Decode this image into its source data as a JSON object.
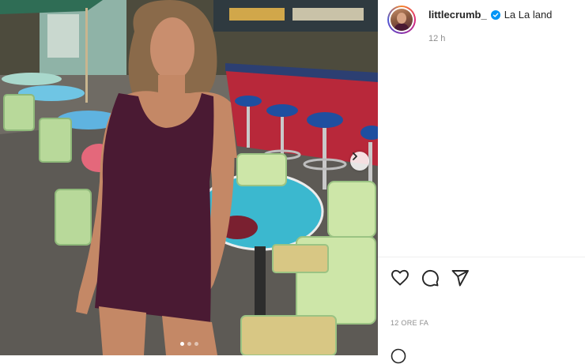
{
  "post": {
    "username": "littlecrumb_",
    "location": "La La land",
    "time_short": "12 h",
    "time_ago": "12 ORE FA",
    "carousel_dots": 3,
    "active_dot": 0
  },
  "icons": {
    "verified": "verified-badge-icon",
    "like": "heart-icon",
    "comment": "comment-icon",
    "share": "send-icon",
    "next": "chevron-right-icon"
  },
  "colors": {
    "verified_blue": "#0095f6",
    "text_primary": "#262626",
    "text_secondary": "#8e8e8e"
  }
}
